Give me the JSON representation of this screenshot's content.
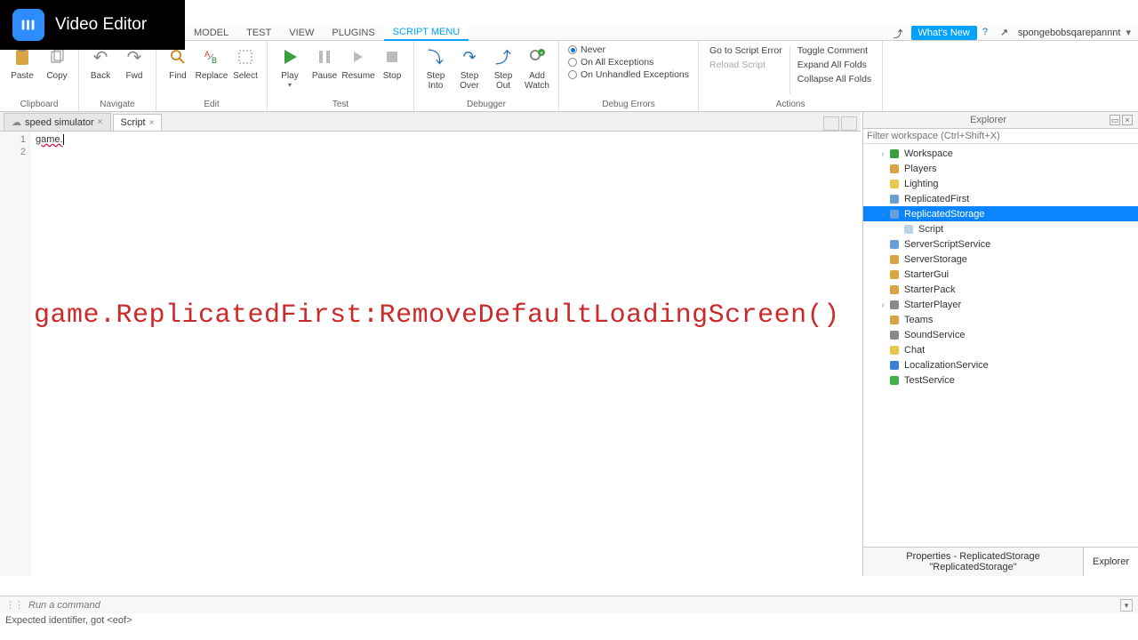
{
  "overlay": {
    "title": "Video Editor"
  },
  "menu_tabs": {
    "items": [
      "MODEL",
      "TEST",
      "VIEW",
      "PLUGINS",
      "SCRIPT MENU"
    ],
    "active_index": 4
  },
  "topright": {
    "whats_new": "What's New",
    "username": "spongebobsqarepannnt"
  },
  "ribbon": {
    "clipboard": {
      "paste": "Paste",
      "copy": "Copy",
      "group": "Clipboard"
    },
    "navigate": {
      "back": "Back",
      "fwd": "Fwd",
      "group": "Navigate"
    },
    "edit": {
      "find": "Find",
      "replace": "Replace",
      "select": "Select",
      "group": "Edit"
    },
    "test": {
      "play": "Play",
      "pause": "Pause",
      "resume": "Resume",
      "stop": "Stop",
      "group": "Test"
    },
    "debugger": {
      "step_into": "Step Into",
      "step_over": "Step Over",
      "step_out": "Step Out",
      "add_watch": "Add Watch",
      "group": "Debugger"
    },
    "debug_errors": {
      "never": "Never",
      "all_exceptions": "On All Exceptions",
      "unhandled": "On Unhandled Exceptions",
      "group": "Debug Errors"
    },
    "actions": {
      "goto": "Go to Script Error",
      "reload": "Reload Script",
      "toggle_comment": "Toggle Comment",
      "expand": "Expand All Folds",
      "collapse": "Collapse All Folds",
      "group": "Actions"
    }
  },
  "file_tabs": {
    "items": [
      {
        "label": "speed simulator",
        "active": false
      },
      {
        "label": "Script",
        "active": true
      }
    ]
  },
  "code": {
    "lines": [
      "1",
      "2"
    ],
    "line1": "game.",
    "overlay_text": "game.ReplicatedFirst:RemoveDefaultLoadingScreen()"
  },
  "explorer": {
    "title": "Explorer",
    "filter_placeholder": "Filter workspace (Ctrl+Shift+X)",
    "tree": [
      {
        "label": "Workspace",
        "depth": 1,
        "exp": "›",
        "color": "#3a9f3a"
      },
      {
        "label": "Players",
        "depth": 1,
        "exp": "",
        "color": "#d9a441"
      },
      {
        "label": "Lighting",
        "depth": 1,
        "exp": "",
        "color": "#e8c84b"
      },
      {
        "label": "ReplicatedFirst",
        "depth": 1,
        "exp": "",
        "color": "#6aa0d8"
      },
      {
        "label": "ReplicatedStorage",
        "depth": 1,
        "exp": "⌄",
        "color": "#6aa0d8",
        "selected": true
      },
      {
        "label": "Script",
        "depth": 2,
        "exp": "",
        "color": "#bcd3e6"
      },
      {
        "label": "ServerScriptService",
        "depth": 1,
        "exp": "",
        "color": "#6aa0d8"
      },
      {
        "label": "ServerStorage",
        "depth": 1,
        "exp": "",
        "color": "#d9a441"
      },
      {
        "label": "StarterGui",
        "depth": 1,
        "exp": "",
        "color": "#d9a441"
      },
      {
        "label": "StarterPack",
        "depth": 1,
        "exp": "",
        "color": "#d9a441"
      },
      {
        "label": "StarterPlayer",
        "depth": 1,
        "exp": "›",
        "color": "#8a8a8a"
      },
      {
        "label": "Teams",
        "depth": 1,
        "exp": "",
        "color": "#d9a441"
      },
      {
        "label": "SoundService",
        "depth": 1,
        "exp": "",
        "color": "#8a8a8a"
      },
      {
        "label": "Chat",
        "depth": 1,
        "exp": "",
        "color": "#e8c84b"
      },
      {
        "label": "LocalizationService",
        "depth": 1,
        "exp": "",
        "color": "#3a7fd8"
      },
      {
        "label": "TestService",
        "depth": 1,
        "exp": "",
        "color": "#43b04a"
      }
    ],
    "properties_title": "Properties - ReplicatedStorage \"ReplicatedStorage\"",
    "explorer_tab": "Explorer"
  },
  "cmd": {
    "placeholder": "Run a command"
  },
  "status": {
    "text": "Expected identifier, got <eof>"
  }
}
